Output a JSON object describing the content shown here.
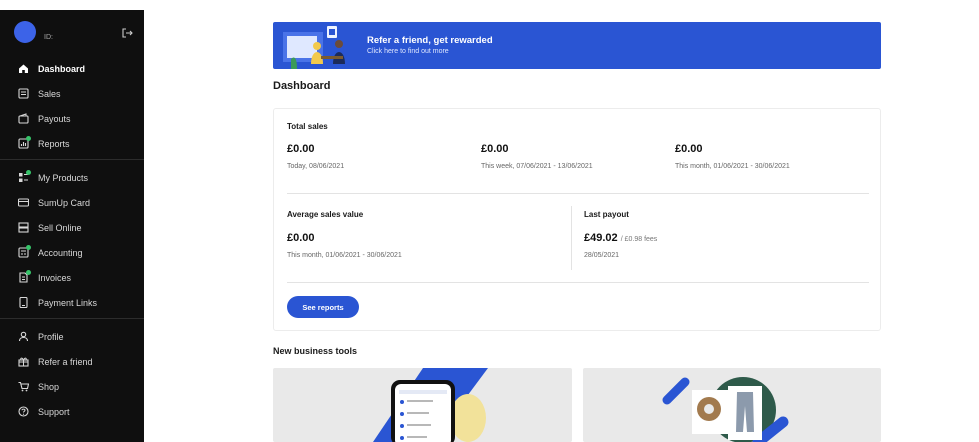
{
  "sidebar": {
    "account_label": "ID:",
    "items": [
      {
        "label": "Dashboard",
        "icon": "home-icon",
        "active": true
      },
      {
        "label": "Sales",
        "icon": "receipt-icon"
      },
      {
        "label": "Payouts",
        "icon": "wallet-icon"
      },
      {
        "label": "Reports",
        "icon": "chart-icon",
        "badge": true
      }
    ],
    "items2": [
      {
        "label": "My Products",
        "icon": "products-icon",
        "badge": true
      },
      {
        "label": "SumUp Card",
        "icon": "card-icon"
      },
      {
        "label": "Sell Online",
        "icon": "store-icon"
      },
      {
        "label": "Accounting",
        "icon": "calculator-icon",
        "badge": true
      },
      {
        "label": "Invoices",
        "icon": "invoice-icon",
        "badge": true
      },
      {
        "label": "Payment Links",
        "icon": "phone-icon"
      }
    ],
    "items3": [
      {
        "label": "Profile",
        "icon": "person-icon"
      },
      {
        "label": "Refer a friend",
        "icon": "gift-icon"
      },
      {
        "label": "Shop",
        "icon": "cart-icon"
      },
      {
        "label": "Support",
        "icon": "help-icon"
      }
    ]
  },
  "banner": {
    "title": "Refer a friend, get rewarded",
    "subtitle": "Click here to find out more"
  },
  "page_title": "Dashboard",
  "total_sales": {
    "label": "Total sales",
    "today": {
      "amount": "£0.00",
      "period": "Today, 08/06/2021"
    },
    "week": {
      "amount": "£0.00",
      "period": "This week, 07/06/2021 - 13/06/2021"
    },
    "month": {
      "amount": "£0.00",
      "period": "This month, 01/06/2021 - 30/06/2021"
    }
  },
  "average_sales": {
    "label": "Average sales value",
    "amount": "£0.00",
    "period": "This month, 01/06/2021 - 30/06/2021"
  },
  "last_payout": {
    "label": "Last payout",
    "amount": "£49.02",
    "fees": "/ £0.98 fees",
    "date": "28/05/2021"
  },
  "see_reports_label": "See reports",
  "tools_title": "New business tools",
  "colors": {
    "accent": "#2a55d3",
    "sidebar": "#0f0f0f",
    "badge": "#36c46a"
  }
}
